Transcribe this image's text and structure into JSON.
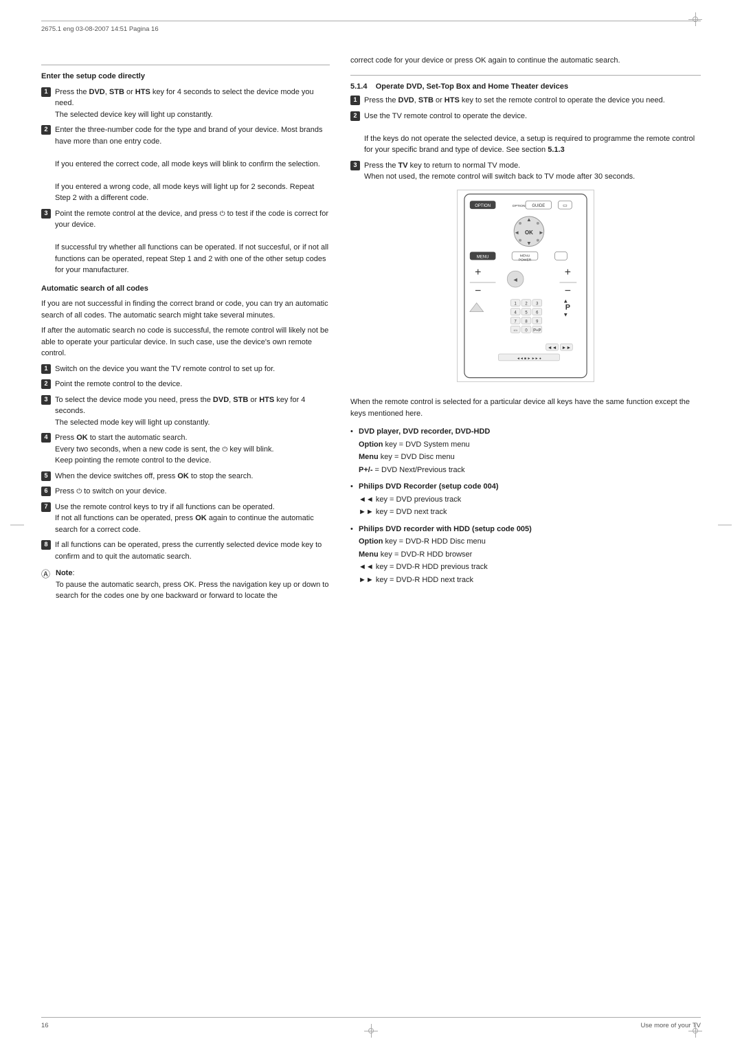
{
  "header": {
    "text": "2675.1 eng  03-08-2007  14:51  Pagina 16"
  },
  "footer": {
    "page_number": "16",
    "section_label": "Use more of your TV"
  },
  "left_column": {
    "section1": {
      "title": "Enter the setup code directly",
      "items": [
        {
          "num": "1",
          "text_parts": [
            {
              "text": "Press the ",
              "bold": false
            },
            {
              "text": "DVD",
              "bold": true
            },
            {
              "text": ", ",
              "bold": false
            },
            {
              "text": "STB",
              "bold": true
            },
            {
              "text": "  or ",
              "bold": false
            },
            {
              "text": "HTS",
              "bold": true
            },
            {
              "text": "  key for 4 seconds to select the device mode you need.",
              "bold": false
            }
          ],
          "continuation": "The selected device key will light up constantly."
        },
        {
          "num": "2",
          "text": "Enter the three-number code for the type and brand of your device. Most brands have more than one entry code.",
          "continuation1": "If you entered the correct code,  all mode keys will blink to confirm the selection.",
          "continuation2": "If you entered a wrong code, all mode keys will light up for 2 seconds. Repeat Step 2 with a different code."
        },
        {
          "num": "3",
          "text_parts": [
            {
              "text": "Point the remote control at the device, and press ",
              "bold": false
            },
            {
              "text": "⏻",
              "bold": false
            },
            {
              "text": " to test if the code is correct for your device.",
              "bold": false
            }
          ],
          "continuation1": "If successful try whether all functions can be operated. If not succesful, or if not all functions can be operated, repeat Step 1 and 2 with one of the other setup codes for your manufacturer."
        }
      ]
    },
    "section2": {
      "title": "Automatic search of all codes",
      "intro1": "If you are not successful in finding the correct brand or code, you can try an automatic search of all codes. The automatic search might take several minutes.",
      "intro2": "If after the automatic search no code is successful, the remote control will likely not be able to operate your particular device. In such case, use the device's own remote control.",
      "items": [
        {
          "num": "1",
          "text": "Switch on the device you want the TV remote control to set up for."
        },
        {
          "num": "2",
          "text": "Point the remote control to the device."
        },
        {
          "num": "3",
          "text_parts": [
            {
              "text": "To select the device mode you need, press the ",
              "bold": false
            },
            {
              "text": "DVD",
              "bold": true
            },
            {
              "text": ", ",
              "bold": false
            },
            {
              "text": "STB",
              "bold": true
            },
            {
              "text": " or ",
              "bold": false
            },
            {
              "text": "HTS",
              "bold": true
            },
            {
              "text": " key for 4 seconds.",
              "bold": false
            }
          ],
          "continuation": "The selected mode key will light up constantly."
        },
        {
          "num": "4",
          "text_parts": [
            {
              "text": "Press ",
              "bold": false
            },
            {
              "text": "OK",
              "bold": true
            },
            {
              "text": " to start the automatic search.",
              "bold": false
            }
          ],
          "continuation1": "Every two seconds, when a new code is sent, the ",
          "continuation1b": "⏻",
          "continuation1c": " key will blink.",
          "continuation2": "Keep pointing the remote control to the device."
        },
        {
          "num": "5",
          "text_parts": [
            {
              "text": "When the device switches off, press ",
              "bold": false
            },
            {
              "text": "OK",
              "bold": true
            },
            {
              "text": " to stop the search.",
              "bold": false
            }
          ]
        },
        {
          "num": "6",
          "text_parts": [
            {
              "text": "Press ",
              "bold": false
            },
            {
              "text": "⏻",
              "bold": false
            },
            {
              "text": " to switch on your device.",
              "bold": false
            }
          ]
        },
        {
          "num": "7",
          "text": "Use the remote control keys to try if all functions can be operated.",
          "continuation1": "If not all functions can be operated, press ",
          "continuation1b": "OK",
          "continuation1c": " again to continue the automatic search for a correct code."
        },
        {
          "num": "8",
          "text": "If all functions can be operated, press the currently selected device mode key to confirm and to quit the automatic search."
        }
      ]
    },
    "note": {
      "label": "Note",
      "text": "To pause the automatic search, press OK. Press the navigation key up or down to search for the codes one by one backward or forward to locate the"
    }
  },
  "right_column": {
    "intro_text": "correct code for your device or press OK again to continue the automatic search.",
    "section_514": {
      "title": "5.1.4",
      "subtitle": "Operate DVD, Set-Top Box and Home Theater devices",
      "items": [
        {
          "num": "1",
          "text_parts": [
            {
              "text": "Press the ",
              "bold": false
            },
            {
              "text": "DVD",
              "bold": true
            },
            {
              "text": ", ",
              "bold": false
            },
            {
              "text": "STB",
              "bold": true
            },
            {
              "text": " or ",
              "bold": false
            },
            {
              "text": "HTS",
              "bold": true
            },
            {
              "text": " key to set the remote control to operate the device you need.",
              "bold": false
            }
          ]
        },
        {
          "num": "2",
          "text": "Use the TV remote control to operate the device.",
          "continuation": "If the keys do not operate the selected device, a setup is required to programme the remote control for your specific brand and type of device. See section 5.1.3"
        },
        {
          "num": "3",
          "text_parts": [
            {
              "text": "Press the ",
              "bold": false
            },
            {
              "text": "TV",
              "bold": true
            },
            {
              "text": " key to return to normal TV mode.",
              "bold": false
            }
          ],
          "continuation": "When not used, the remote control will switch back to TV mode after 30 seconds."
        }
      ]
    },
    "remote_description": "When the remote control is selected for a particular device all keys have the same function except the keys mentioned here.",
    "bullet_items": [
      {
        "title": "DVD player, DVD recorder, DVD-HDD",
        "sub": [
          {
            "text": "Option",
            "bold": true,
            "rest": " key = DVD System menu"
          },
          {
            "text": "Menu",
            "bold": true,
            "rest": " key = DVD Disc menu"
          },
          {
            "text": "P+/-",
            "bold": true,
            "rest": " = DVD Next/Previous track"
          }
        ]
      },
      {
        "title": "Philips DVD Recorder (setup code 004)",
        "sub": [
          {
            "text": "◄◄",
            "bold": false,
            "rest": " key = DVD previous track"
          },
          {
            "text": "►►",
            "bold": false,
            "rest": " key = DVD next track"
          }
        ]
      },
      {
        "title": "Philips DVD recorder with HDD (setup code 005)",
        "sub": [
          {
            "text": "Option",
            "bold": true,
            "rest": " key = DVD-R HDD Disc menu"
          },
          {
            "text": "Menu",
            "bold": true,
            "rest": " key = DVD-R HDD browser"
          },
          {
            "text": "◄◄",
            "bold": false,
            "rest": " key = DVD-R HDD previous track"
          },
          {
            "text": "►►",
            "bold": false,
            "rest": " key = DVD-R HDD next track"
          }
        ]
      }
    ]
  }
}
